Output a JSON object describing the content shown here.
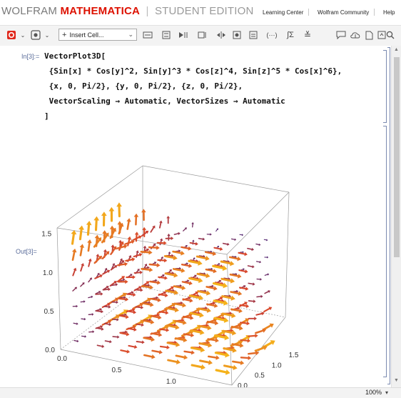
{
  "brand": {
    "wolfram": "WOLFRAM",
    "mathematica": "MATHEMATICA",
    "separator": "|",
    "edition": "STUDENT EDITION"
  },
  "top_links": [
    "Learning Center",
    "Wolfram Community",
    "Help"
  ],
  "toolbar": {
    "insert_cell_label": "Insert Cell..."
  },
  "cell": {
    "in_label": "In[3]:=",
    "out_label": "Out[3]=",
    "code_lines": [
      "VectorPlot3D[",
      " {Sin[x] * Cos[y]^2, Sin[y]^3 * Cos[z]^4, Sin[z]^5 * Cos[x]^6},",
      " {x, 0, Pi/2}, {y, 0, Pi/2}, {z, 0, Pi/2},",
      " VectorScaling → Automatic, VectorSizes → Automatic",
      "]"
    ]
  },
  "chart_data": {
    "type": "vector_field_3d",
    "function": "VectorPlot3D",
    "field": [
      "Sin[x] Cos[y]^2",
      "Sin[y]^3 Cos[z]^4",
      "Sin[z]^5 Cos[x]^6"
    ],
    "x_range": [
      0,
      1.5708
    ],
    "y_range": [
      0,
      1.5708
    ],
    "z_range": [
      0,
      1.5708
    ],
    "grid_points": 7,
    "x_ticks": [
      "0.0",
      "0.5",
      "1.0",
      "1.5"
    ],
    "y_ticks": [
      "0.0",
      "0.5",
      "1.0",
      "1.5"
    ],
    "z_ticks": [
      "0.0",
      "0.5",
      "1.0",
      "1.5"
    ],
    "color_low": "#4b1f6f",
    "color_mid": "#d8452c",
    "color_high": "#f5b21a"
  },
  "status": {
    "zoom": "100%"
  }
}
